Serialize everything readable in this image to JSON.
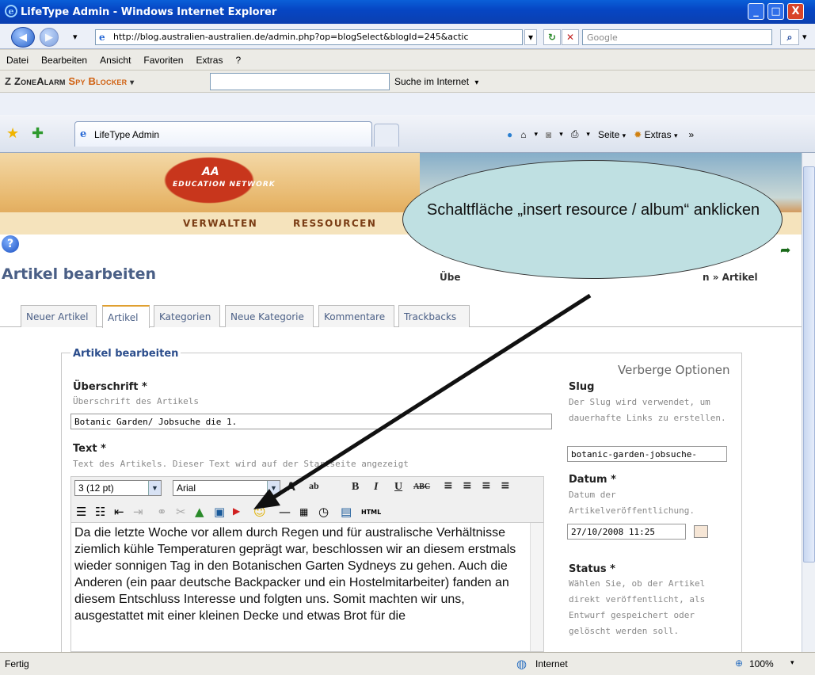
{
  "window": {
    "title": "LifeType Admin - Windows Internet Explorer",
    "ie_glyph": "e",
    "minimize": "_",
    "maximize": "□",
    "close": "X"
  },
  "addressbar": {
    "url": "http://blog.australien-australien.de/admin.php?op=blogSelect&blogId=245&actic",
    "search_placeholder": "Google",
    "back": "◀",
    "forward": "▶",
    "dropdown": "▾",
    "refresh": "↻",
    "stop": "✕",
    "search_icon": "⌕"
  },
  "menubar": {
    "items": [
      "Datei",
      "Bearbeiten",
      "Ansicht",
      "Favoriten",
      "Extras",
      "?"
    ]
  },
  "zonealarm": {
    "logo_z": "Z",
    "logo_brand": "ZoneAlarm",
    "logo_product": "Spy Blocker",
    "logo_dropdown": "▾",
    "search_label": "Suche im Internet",
    "search_dropdown": "▾"
  },
  "tabbar": {
    "tab_title": "LifeType Admin",
    "star1": "★",
    "star2": "✚",
    "tools": [
      "Seite",
      "Extras"
    ],
    "home_glyph": "⌂",
    "feeds_glyph": "◙",
    "print_glyph": "⎙",
    "overflow": "»"
  },
  "page": {
    "banner": {
      "aa": "AA",
      "edu": "EDUCATION NETWORK"
    },
    "nav": [
      "VERWALTEN",
      "RESSOURCEN"
    ],
    "help": "?",
    "title": "Artikel bearbeiten",
    "breadcrumb_left": "Übe",
    "breadcrumb_right": "n » Artikel",
    "go": "➦",
    "tabs": [
      "Neuer Artikel",
      "Artikel",
      "Kategorien",
      "Neue Kategorie",
      "Kommentare",
      "Trackbacks"
    ],
    "active_tab": "Artikel"
  },
  "form": {
    "legend": "Artikel bearbeiten",
    "toggle_options": "Verberge Optionen",
    "heading_label": "Überschrift *",
    "heading_hint": "Überschrift des Artikels",
    "heading_value": "Botanic Garden/ Jobsuche die 1.",
    "text_label": "Text *",
    "text_hint": "Text des Artikels. Dieser Text wird auf der Startseite angezeigt",
    "fontsize": "3 (12 pt)",
    "fontface": "Arial",
    "html_btn": "HTML",
    "body": "Da die letzte Woche vor allem durch Regen und für australische Verhältnisse ziemlich kühle Temperaturen geprägt war, beschlossen wir an diesem erstmals wieder sonnigen Tag in den Botanischen Garten Sydneys zu gehen. Auch die Anderen (ein paar deutsche Backpacker und ein Hostelmitarbeiter) fanden an diesem Entschluss Interesse und folgten uns. Somit machten wir uns, ausgestattet mit einer kleinen Decke und etwas Brot für die"
  },
  "sidebar": {
    "slug_label": "Slug",
    "slug_hint": "Der Slug wird verwendet, um dauerhafte Links zu erstellen.",
    "slug_value": "botanic-garden-jobsuche-",
    "date_label": "Datum *",
    "date_hint": "Datum der Artikelveröffentlichung.",
    "date_value": "27/10/2008 11:25",
    "status_label": "Status *",
    "status_hint": "Wählen Sie, ob der Artikel direkt veröffentlicht, als Entwurf gespeichert oder gelöscht werden soll."
  },
  "statusbar": {
    "status": "Fertig",
    "zone": "Internet",
    "zoom": "100%",
    "zone_glyph": "◍",
    "zoom_glyph": "⊕",
    "zoom_dropdown": "▾"
  },
  "annotation": {
    "text": "Schaltfläche „insert resource / album“ anklicken"
  }
}
